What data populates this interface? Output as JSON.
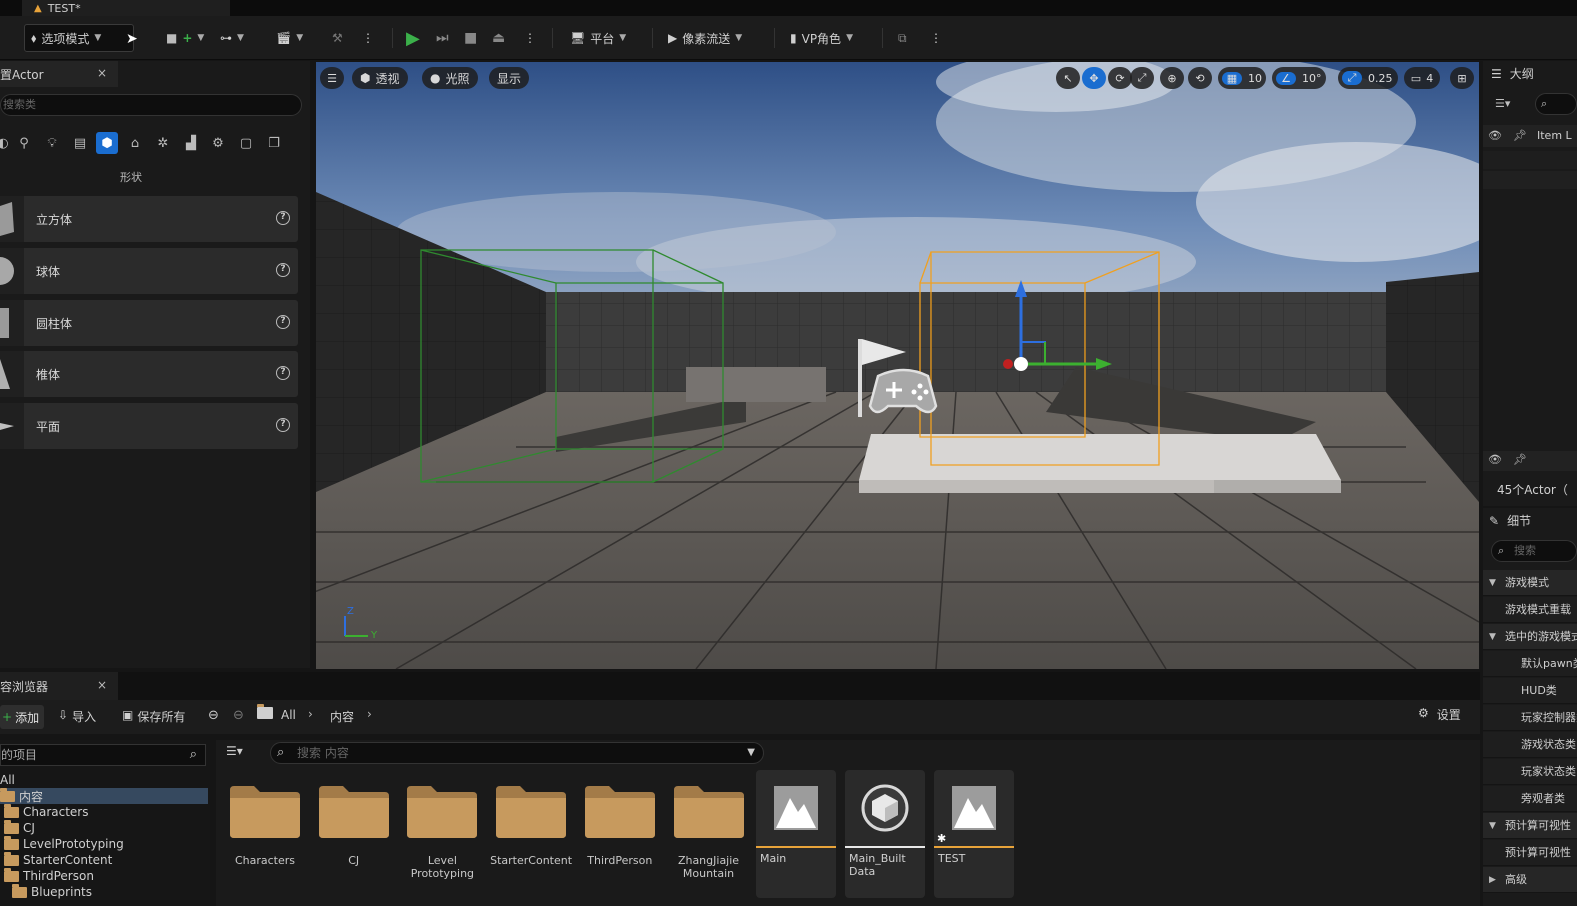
{
  "app": {
    "doc_tab": "TEST*"
  },
  "toolbar": {
    "mode_label": "选项模式",
    "platform_label": "平台",
    "pixel_stream_label": "像素流送",
    "vp_role_label": "VP角色"
  },
  "place_actor": {
    "tab_label": "置Actor",
    "close": "×",
    "search_placeholder": "搜索类",
    "category_label": "形状",
    "shapes": [
      {
        "label": "立方体"
      },
      {
        "label": "球体"
      },
      {
        "label": "圆柱体"
      },
      {
        "label": "椎体"
      },
      {
        "label": "平面"
      }
    ],
    "help": "?"
  },
  "viewport": {
    "perspective_label": "透视",
    "lighting_label": "光照",
    "show_label": "显示",
    "grid_snap": "10",
    "rotation_snap": "10°",
    "scale_snap": "0.25",
    "camera_speed": "4",
    "axis_z": "Z",
    "axis_y": "Y"
  },
  "outliner": {
    "title": "大纲",
    "column_item": "Item L",
    "actor_count": "45个Actor（"
  },
  "details": {
    "title": "细节",
    "search_placeholder": "搜索",
    "rows": [
      {
        "label": "游戏模式",
        "type": "category"
      },
      {
        "label": "游戏模式重载",
        "type": "item"
      },
      {
        "label": "选中的游戏模式",
        "type": "category"
      },
      {
        "label": "默认pawn类",
        "type": "subitem"
      },
      {
        "label": "HUD类",
        "type": "subitem"
      },
      {
        "label": "玩家控制器类",
        "type": "subitem"
      },
      {
        "label": "游戏状态类",
        "type": "subitem"
      },
      {
        "label": "玩家状态类",
        "type": "subitem"
      },
      {
        "label": "旁观者类",
        "type": "subitem"
      },
      {
        "label": "预计算可视性",
        "type": "category"
      },
      {
        "label": "预计算可视性",
        "type": "item"
      },
      {
        "label": "高级",
        "type": "category"
      }
    ]
  },
  "content_browser": {
    "tab_label": "容浏览器",
    "close": "×",
    "add_label": "添加",
    "import_label": "导入",
    "save_all_label": "保存所有",
    "path_all": "All",
    "path_content": "内容",
    "settings_label": "设置",
    "tree_search_placeholder": "的项目",
    "asset_search_placeholder": "搜索 内容",
    "tree": [
      {
        "label": "All",
        "depth": 0,
        "folder": false
      },
      {
        "label": "内容",
        "depth": 0,
        "folder": true,
        "selected": true
      },
      {
        "label": "Characters",
        "depth": 1,
        "folder": true
      },
      {
        "label": "CJ",
        "depth": 1,
        "folder": true
      },
      {
        "label": "LevelPrototyping",
        "depth": 1,
        "folder": true
      },
      {
        "label": "StarterContent",
        "depth": 1,
        "folder": true
      },
      {
        "label": "ThirdPerson",
        "depth": 1,
        "folder": true
      },
      {
        "label": "Blueprints",
        "depth": 2,
        "folder": true
      }
    ],
    "folders": [
      {
        "label": "Characters"
      },
      {
        "label": "CJ"
      },
      {
        "label": "Level Prototyping"
      },
      {
        "label": "StarterContent"
      },
      {
        "label": "ThirdPerson"
      },
      {
        "label": "ZhangJiajie Mountain"
      }
    ],
    "assets": [
      {
        "label": "Main",
        "bar_color": "#e8a33a"
      },
      {
        "label": "Main_Built Data",
        "bar_color": "#e8e8e8"
      },
      {
        "label": "TEST",
        "bar_color": "#e8a33a"
      }
    ]
  },
  "colors": {
    "accent_blue": "#1a6dd0",
    "play_green": "#3bb04a",
    "folder_tan": "#c79a5e",
    "selection_orange": "#f0a020",
    "volume_green": "#2f8a2f"
  }
}
